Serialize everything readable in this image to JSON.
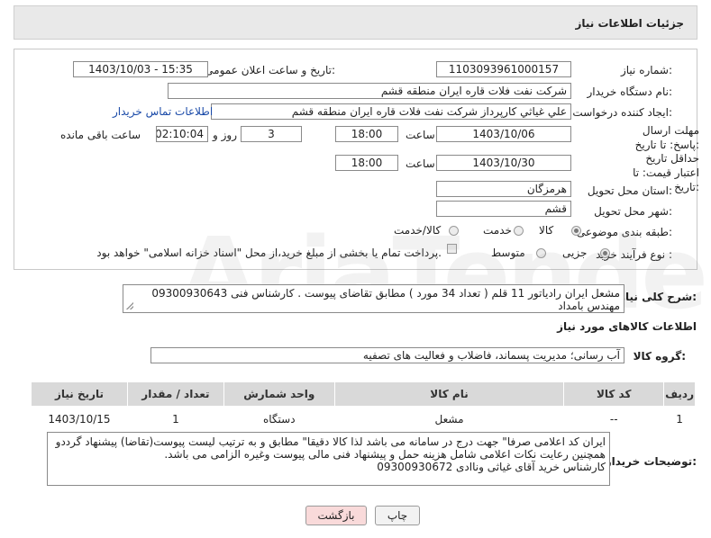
{
  "header": {
    "title": "جزئیات اطلاعات نیاز"
  },
  "labels": {
    "need_number": "شماره نیاز:",
    "announce_datetime": "تاریخ و ساعت اعلان عمومی:",
    "buyer_org": "نام دستگاه خریدار:",
    "requester": "ایجاد کننده درخواست:",
    "buyer_contact_link": "اطلاعات تماس خریدار",
    "reply_deadline": "مهلت ارسال پاسخ: تا تاریخ:",
    "hour": "ساعت",
    "hour2": "ساعت",
    "day_and": "روز و",
    "remaining": "ساعت باقی مانده",
    "price_validity": "حداقل تاریخ اعتبار قیمت: تا تاریخ:",
    "province": "استان محل تحویل:",
    "city": "شهر محل تحویل:",
    "category": "طبقه بندی موضوعی:",
    "purchase_type": "نوع فرآیند خرید :",
    "payment_note": "پرداخت تمام یا بخشی از مبلغ خرید،از محل \"اسناد خزانه اسلامی\" خواهد بود.",
    "need_summary": "شرح کلی نیاز:",
    "goods_info": "اطلاعات کالاهای مورد نیاز",
    "goods_group": "گروه کالا:",
    "buyer_notes": "توضیحات خریدار:"
  },
  "values": {
    "need_number": "1103093961000157",
    "announce_datetime": "1403/10/03 - 15:35",
    "buyer_org": "شرکت نفت فلات قاره ایران منطقه قشم",
    "requester": "علي غياثي كارپرداز شرکت نفت فلات قاره ایران منطقه قشم",
    "reply_date": "1403/10/06",
    "reply_hour": "18:00",
    "days": "3",
    "remaining_time": "02:10:04",
    "validity_date": "1403/10/30",
    "validity_hour": "18:00",
    "province": "هرمزگان",
    "city": "قشم",
    "need_summary": "مشعل ایران رادیاتور 11 قلم ( تعداد 34 مورد ) مطابق تقاضای پیوست . کارشناس فنی 09300930643  مهندس بامداد",
    "goods_group": "آب رسانی؛ مدیریت پسماند، فاضلاب و فعالیت های تصفیه",
    "buyer_notes_line1": "ایران کد اعلامی صرفا\" جهت درج در سامانه می باشد لذا  کالا دقیقا\" مطابق و به ترتیب لیست پیوست(تقاضا) پیشنهاد گرددو",
    "buyer_notes_line2": "همچنین رعایت نکات اعلامی شامل هزینه حمل و پیشنهاد فنی مالی پیوست وغیره الزامی می باشد.",
    "buyer_notes_line3": "کارشناس خرید آقای غیاثی وناادی 09300930672"
  },
  "category_options": {
    "goods": "کالا",
    "service": "خدمت",
    "goods_service": "کالا/خدمت",
    "selected": "کالا"
  },
  "purchase_options": {
    "partial": "جزیی",
    "medium": "متوسط",
    "selected": "جزیی"
  },
  "table": {
    "headers": [
      "ردیف",
      "کد کالا",
      "نام کالا",
      "واحد شمارش",
      "تعداد / مقدار",
      "تاریخ نیاز"
    ],
    "rows": [
      [
        "1",
        "--",
        "مشعل",
        "دستگاه",
        "1",
        "1403/10/15"
      ]
    ]
  },
  "buttons": {
    "print": "چاپ",
    "back": "بازگشت"
  },
  "watermark": "AriaTender.neT"
}
